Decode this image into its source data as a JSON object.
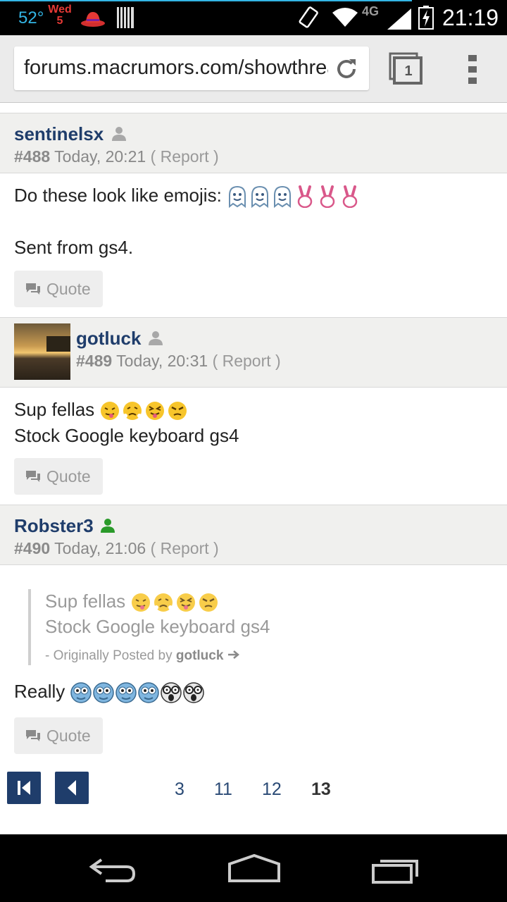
{
  "status_bar": {
    "temperature": "52°",
    "day_name": "Wed",
    "day_number": "5",
    "network_type": "4G",
    "time": "21:19",
    "icons": [
      "weather-temp",
      "calendar-icon",
      "hat-icon",
      "barcode-icon",
      "screen-rotate-icon",
      "wifi-icon",
      "signal-icon",
      "battery-charging-icon"
    ]
  },
  "browser": {
    "url": "forums.macrumors.com/showthread.php",
    "tab_count": "1",
    "icons": [
      "reload-icon",
      "tabs-icon",
      "menu-icon"
    ]
  },
  "posts": [
    {
      "username": "sentinelsx",
      "number": "#488",
      "time": "Today, 20:21",
      "report": "( Report )",
      "status_color": "#a8a8a8",
      "line1": "Do these look like emojis:",
      "line1_emojis": [
        "ghost",
        "ghost",
        "ghost",
        "peace-hand",
        "peace-hand",
        "peace-hand"
      ],
      "line2": "Sent from gs4.",
      "quote_label": "Quote"
    },
    {
      "username": "gotluck",
      "number": "#489",
      "time": "Today, 20:31",
      "report": "( Report )",
      "status_color": "#a8a8a8",
      "line1": "Sup fellas",
      "line1_emojis": [
        "tongue-face",
        "steam-face",
        "squint-tongue-face",
        "angry-face"
      ],
      "line2": "Stock Google keyboard gs4",
      "quote_label": "Quote"
    },
    {
      "username": "Robster3",
      "number": "#490",
      "time": "Today, 21:06",
      "report": "( Report )",
      "status_color": "#2a9a2a",
      "quote_line1": "Sup fellas",
      "quote_line2": "Stock Google keyboard gs4",
      "quote_attr_prefix": "- Originally Posted by",
      "quote_attr_user": "gotluck",
      "body": "Really",
      "body_emojis": [
        "blue-face",
        "blue-face",
        "blue-face",
        "blue-face",
        "shocked-face",
        "shocked-face"
      ],
      "quote_label": "Quote"
    }
  ],
  "pagination": {
    "pages": [
      "3",
      "11",
      "12",
      "13"
    ],
    "current": "13",
    "accent": "#1f3d6b"
  }
}
